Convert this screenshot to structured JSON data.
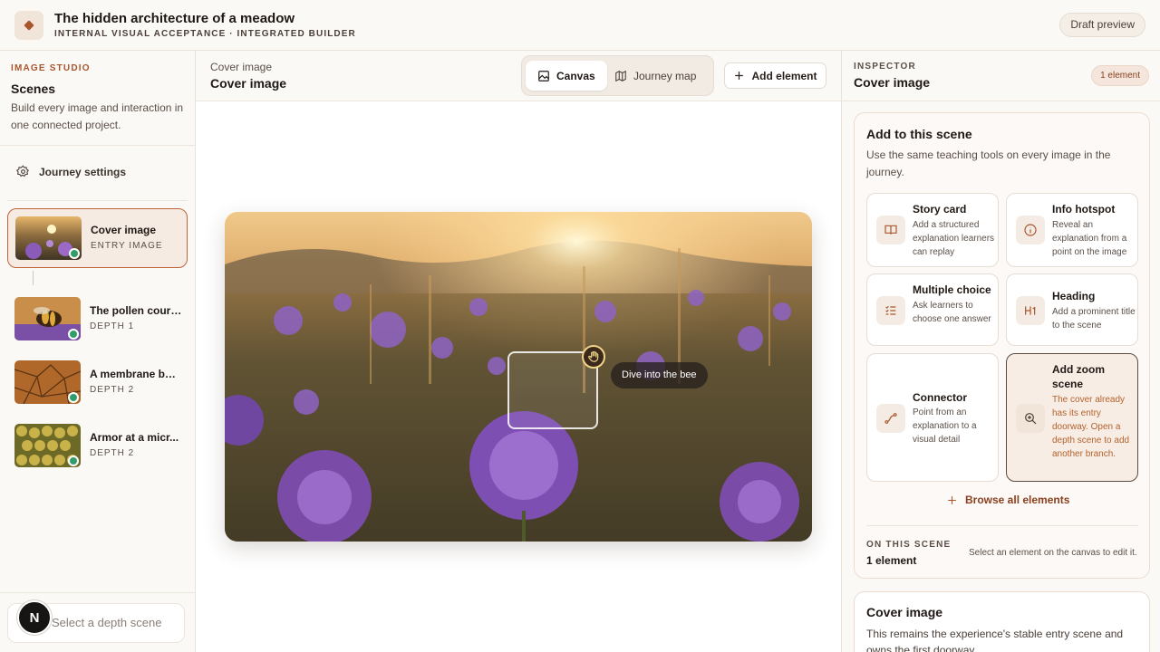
{
  "header": {
    "title": "The hidden architecture of a meadow",
    "subtitle": "INTERNAL VISUAL ACCEPTANCE · INTEGRATED BUILDER",
    "draft_button": "Draft preview",
    "logo_icon": "diamond-icon"
  },
  "sidebar": {
    "eyebrow": "IMAGE STUDIO",
    "heading": "Scenes",
    "description": "Build every image and interaction in one connected project.",
    "journey_settings": "Journey settings",
    "scenes": [
      {
        "name": "Cover image",
        "depth": "ENTRY IMAGE"
      },
      {
        "name": "The pollen courier",
        "depth": "DEPTH 1"
      },
      {
        "name": "A membrane buil...",
        "depth": "DEPTH 2"
      },
      {
        "name": "Armor at a micr...",
        "depth": "DEPTH 2"
      }
    ],
    "depth_select_placeholder": "Select a depth scene",
    "avatar_letter": "N"
  },
  "canvas": {
    "breadcrumb_small": "Cover image",
    "breadcrumb_big": "Cover image",
    "tabs": [
      {
        "label": "Canvas",
        "icon": "image-icon"
      },
      {
        "label": "Journey map",
        "icon": "map-icon"
      }
    ],
    "add_element": "Add element",
    "hotspot_label": "Dive into the bee"
  },
  "inspector": {
    "eyebrow": "INSPECTOR",
    "title": "Cover image",
    "badge": "1 element",
    "panel_title": "Add to this scene",
    "panel_desc": "Use the same teaching tools on every image in the journey.",
    "tools": [
      {
        "name": "Story card",
        "desc": "Add a structured explanation learners can replay",
        "icon": "book-icon"
      },
      {
        "name": "Info hotspot",
        "desc": "Reveal an explanation from a point on the image",
        "icon": "info-icon"
      },
      {
        "name": "Multiple choice",
        "desc": "Ask learners to choose one answer",
        "icon": "list-icon"
      },
      {
        "name": "Heading",
        "desc": "Add a prominent title to the scene",
        "icon": "heading-icon"
      },
      {
        "name": "Connector",
        "desc": "Point from an explanation to a visual detail",
        "icon": "connector-icon"
      },
      {
        "name": "Add zoom scene",
        "desc": "The cover already has its entry doorway. Open a depth scene to add another branch.",
        "icon": "zoom-icon"
      }
    ],
    "browse": "Browse all elements",
    "on_scene_eyebrow": "ON THIS SCENE",
    "on_scene_count": "1 element",
    "on_scene_hint": "Select an element on the canvas to edit it.",
    "cover_title": "Cover image",
    "cover_desc": "This remains the experience's stable entry scene and owns the first doorway."
  }
}
